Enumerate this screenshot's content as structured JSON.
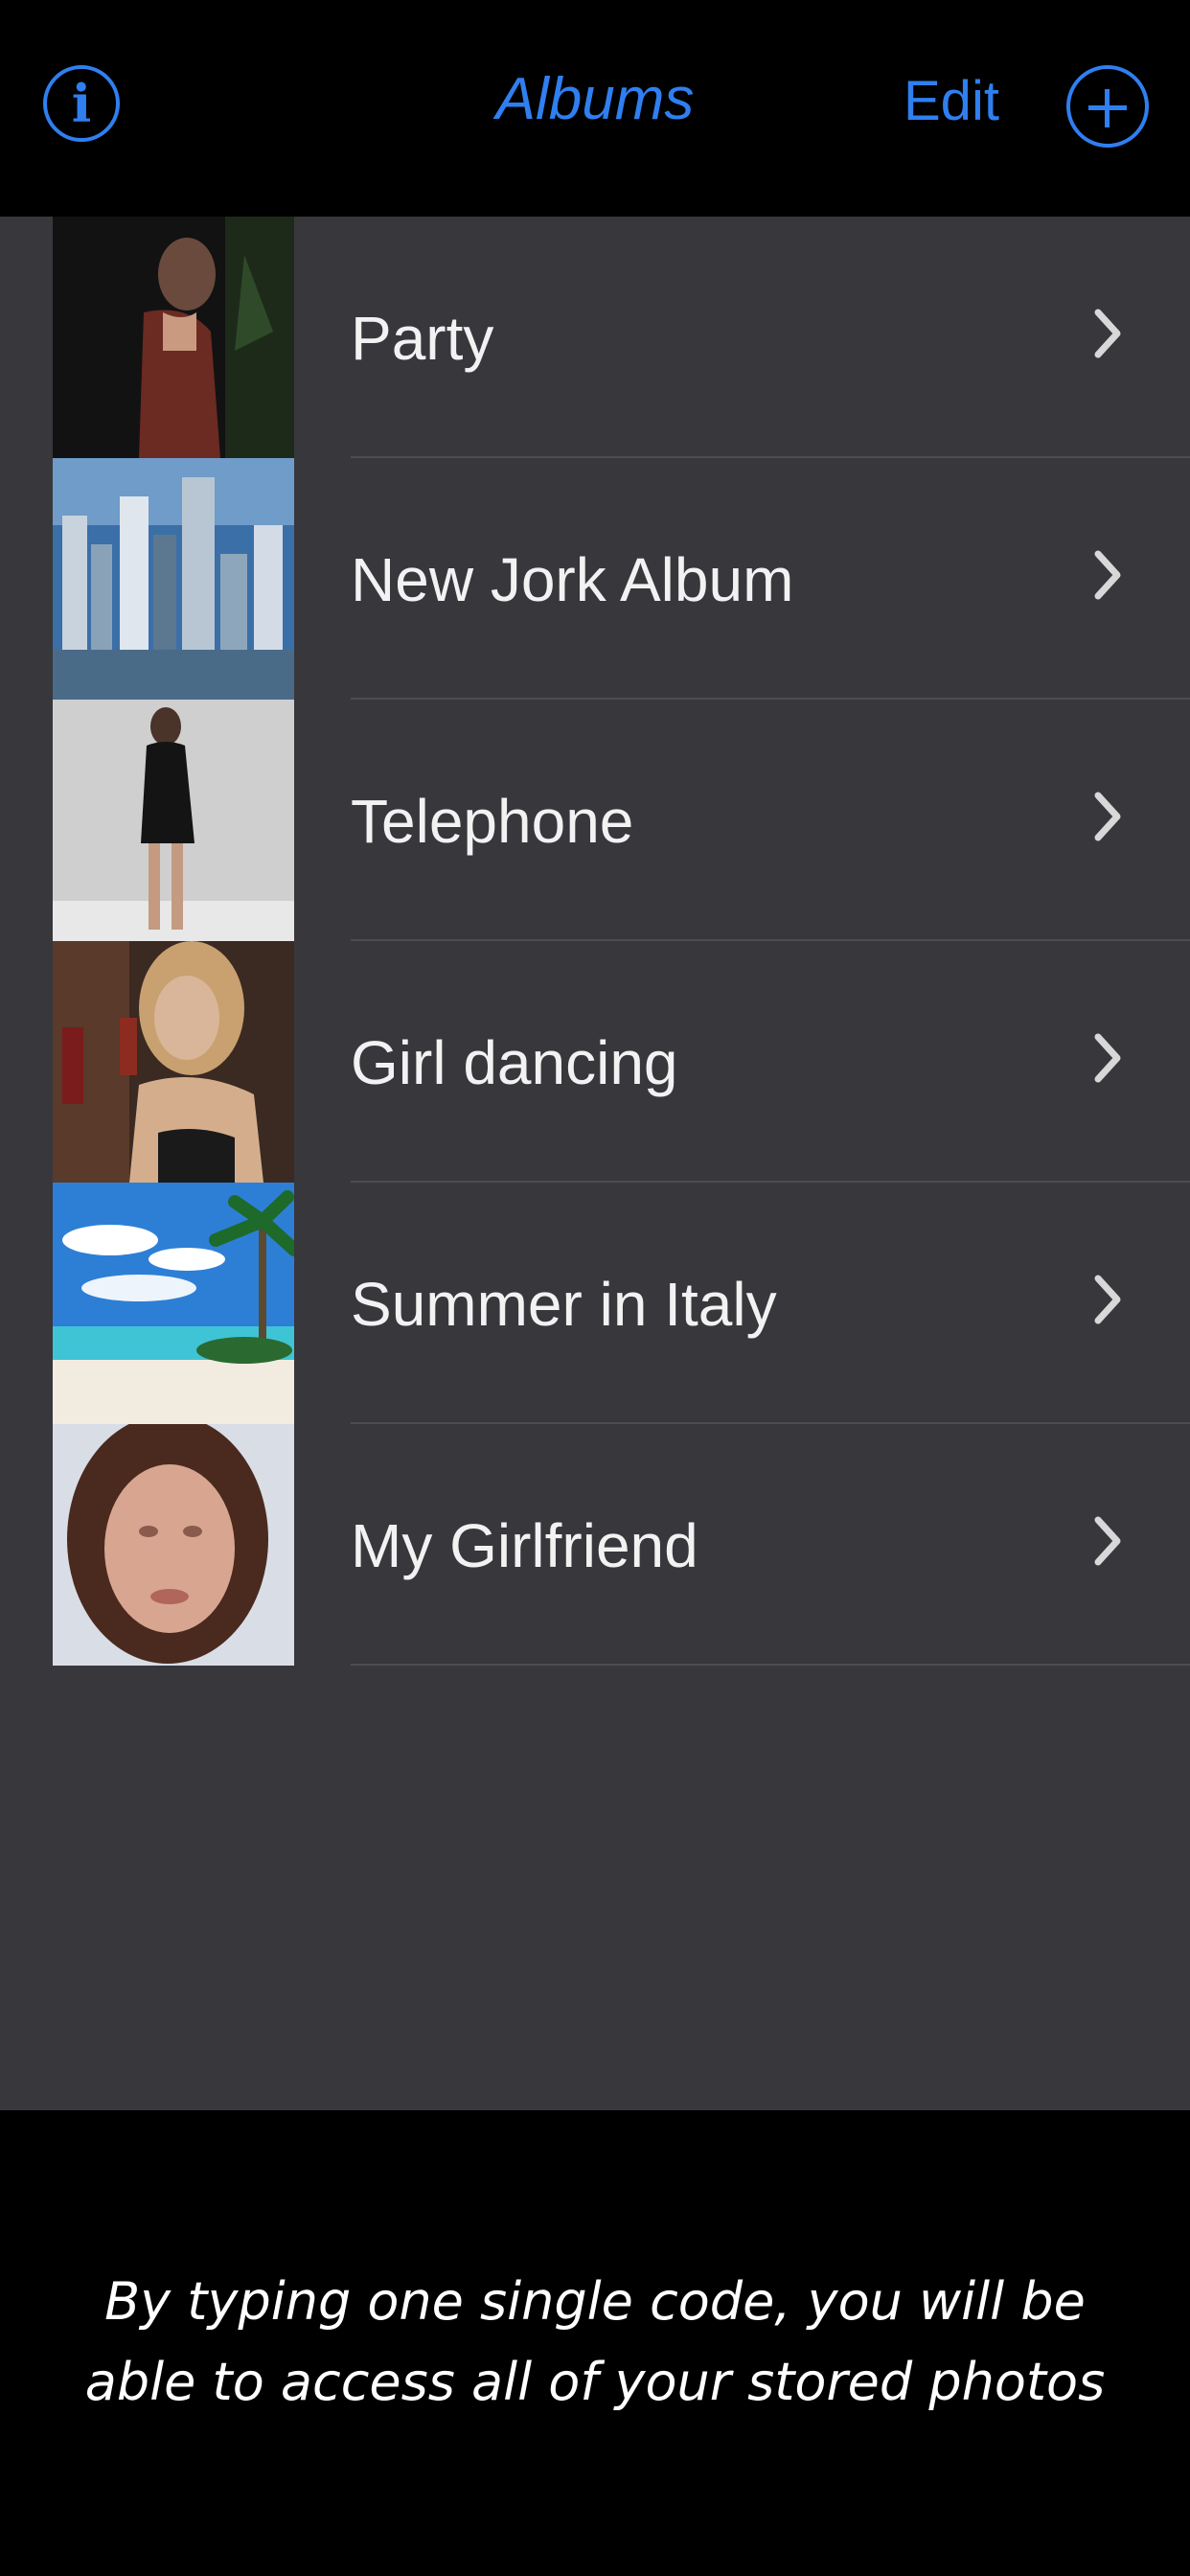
{
  "navbar": {
    "title": "Albums",
    "edit_label": "Edit",
    "info_icon": "info-icon",
    "add_icon": "plus-circle-icon"
  },
  "albums": [
    {
      "label": "Party",
      "thumb": "woman in red dress at night"
    },
    {
      "label": "New Jork Album",
      "thumb": "city skyline"
    },
    {
      "label": "Telephone",
      "thumb": "woman in black dress"
    },
    {
      "label": "Girl dancing",
      "thumb": "woman with drink"
    },
    {
      "label": "Summer in Italy",
      "thumb": "tropical beach"
    },
    {
      "label": "My Girlfriend",
      "thumb": "portrait of woman"
    }
  ],
  "caption": {
    "line1": "By typing one single code, you will be",
    "line2": "able to access all of your stored photos"
  },
  "colors": {
    "accent": "#2f7ff0",
    "list_bg": "#38373c",
    "text": "#f2f2f2"
  }
}
